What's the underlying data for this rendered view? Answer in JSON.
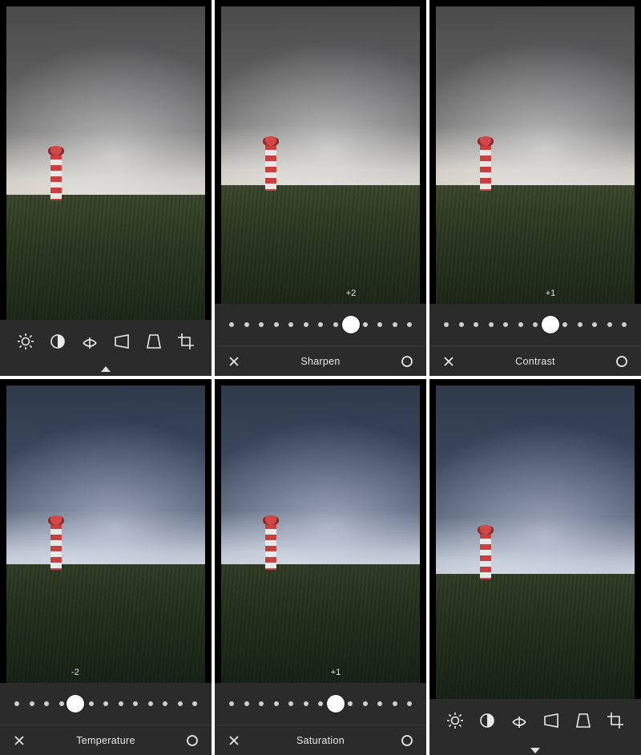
{
  "slider": {
    "dot_count": 13,
    "center_index": 6
  },
  "tools": [
    {
      "name": "exposure",
      "icon": "exposure-icon"
    },
    {
      "name": "contrast",
      "icon": "contrast-icon"
    },
    {
      "name": "straighten",
      "icon": "straighten-icon"
    },
    {
      "name": "skew-h",
      "icon": "skew-h-icon"
    },
    {
      "name": "skew-v",
      "icon": "skew-v-icon"
    },
    {
      "name": "crop",
      "icon": "crop-icon"
    }
  ],
  "panels": [
    {
      "id": "tools-top",
      "mode": "toolbar",
      "photo_variant": "warm",
      "caret": "up"
    },
    {
      "id": "sharpen",
      "mode": "slider",
      "photo_variant": "warm",
      "label": "Sharpen",
      "value_text": "+2",
      "value_offset": 2,
      "cancel": "×",
      "confirm": "○"
    },
    {
      "id": "contrast",
      "mode": "slider",
      "photo_variant": "warm",
      "label": "Contrast",
      "value_text": "+1",
      "value_offset": 1,
      "cancel": "×",
      "confirm": "○"
    },
    {
      "id": "temperature",
      "mode": "slider",
      "photo_variant": "cool",
      "label": "Temperature",
      "value_text": "-2",
      "value_offset": -2,
      "cancel": "×",
      "confirm": "○"
    },
    {
      "id": "saturation",
      "mode": "slider",
      "photo_variant": "cool",
      "label": "Saturation",
      "value_text": "+1",
      "value_offset": 1,
      "cancel": "×",
      "confirm": "○"
    },
    {
      "id": "tools-bottom",
      "mode": "toolbar",
      "photo_variant": "cool",
      "caret": "down"
    }
  ]
}
